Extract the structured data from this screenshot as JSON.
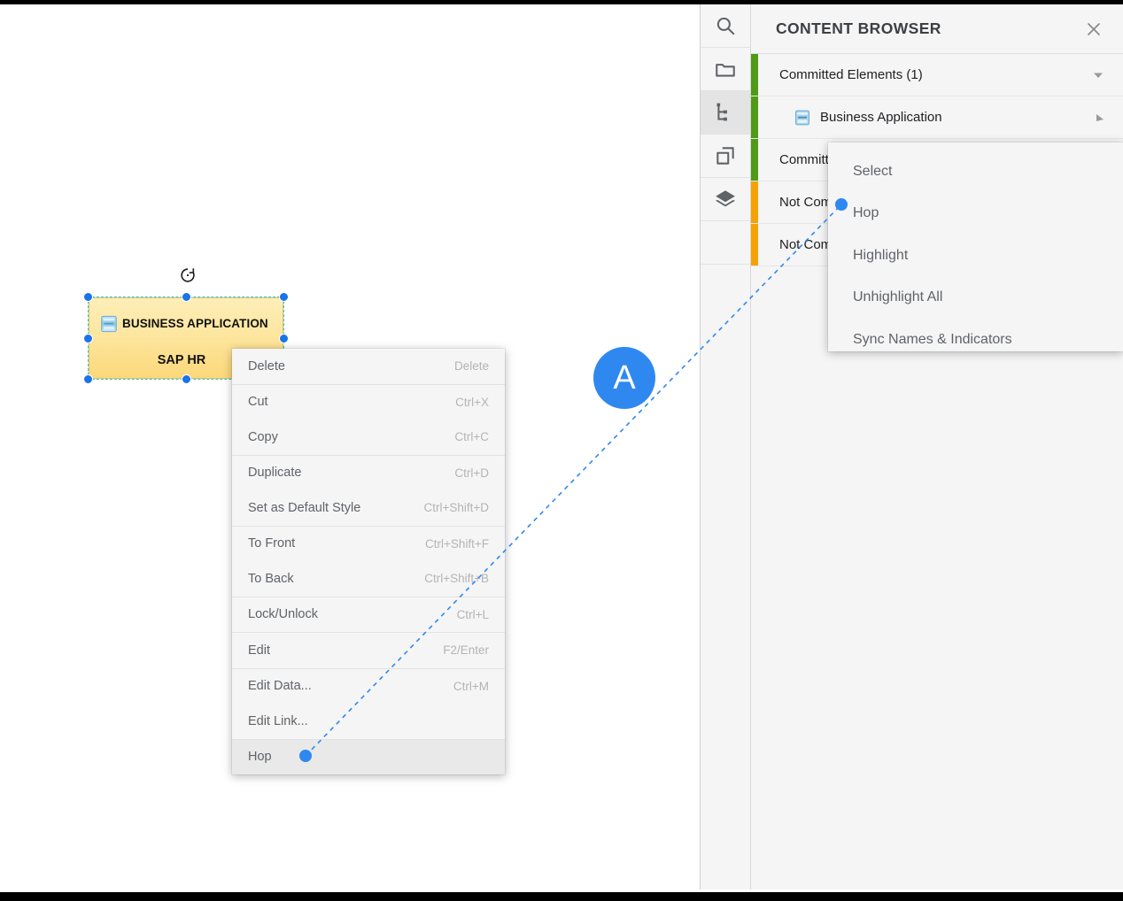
{
  "canvas": {
    "shape": {
      "icon": "business-application-icon",
      "title": "BUSINESS APPLICATION",
      "subtitle": "SAP HR",
      "rotate_icon": "rotate-icon",
      "fill_color": "#fde6a0",
      "selection_color": "#1a73e8",
      "dash_color": "#26c6da"
    }
  },
  "context_menu": {
    "groups": [
      [
        {
          "label": "Delete",
          "accel": "Delete",
          "highlighted": false
        }
      ],
      [
        {
          "label": "Cut",
          "accel": "Ctrl+X",
          "highlighted": false
        },
        {
          "label": "Copy",
          "accel": "Ctrl+C",
          "highlighted": false
        }
      ],
      [
        {
          "label": "Duplicate",
          "accel": "Ctrl+D",
          "highlighted": false
        },
        {
          "label": "Set as Default Style",
          "accel": "Ctrl+Shift+D",
          "highlighted": false
        }
      ],
      [
        {
          "label": "To Front",
          "accel": "Ctrl+Shift+F",
          "highlighted": false
        },
        {
          "label": "To Back",
          "accel": "Ctrl+Shift+B",
          "highlighted": false
        }
      ],
      [
        {
          "label": "Lock/Unlock",
          "accel": "Ctrl+L",
          "highlighted": false
        }
      ],
      [
        {
          "label": "Edit",
          "accel": "F2/Enter",
          "highlighted": false
        }
      ],
      [
        {
          "label": "Edit Data...",
          "accel": "Ctrl+M",
          "highlighted": false
        },
        {
          "label": "Edit Link...",
          "accel": "",
          "highlighted": false
        }
      ],
      [
        {
          "label": "Hop",
          "accel": "",
          "highlighted": true
        }
      ]
    ]
  },
  "right_panel": {
    "rail": [
      {
        "name": "search-icon",
        "active": false
      },
      {
        "name": "folder-icon",
        "active": false
      },
      {
        "name": "tree-icon",
        "active": true
      },
      {
        "name": "copy-icon",
        "active": false
      },
      {
        "name": "layers-icon",
        "active": false
      }
    ],
    "header": {
      "title": "CONTENT BROWSER",
      "close_icon": "close-icon"
    },
    "rows": [
      {
        "label": "Committed Elements (1)",
        "status_color": "#4f9a16",
        "indent": false,
        "icon": null,
        "tail": "chevron-down-icon"
      },
      {
        "label": "Business Application",
        "status_color": "#4f9a16",
        "indent": true,
        "icon": "business-application-icon",
        "tail": "arrow-right-icon"
      },
      {
        "label": "Committed",
        "status_color": "#4f9a16",
        "indent": false,
        "icon": null,
        "tail": null
      },
      {
        "label": "Not Committed",
        "status_color": "#f5a202",
        "indent": false,
        "icon": null,
        "tail": null
      },
      {
        "label": "Not Committed",
        "status_color": "#f5a202",
        "indent": false,
        "icon": null,
        "tail": null
      }
    ]
  },
  "submenu": {
    "items": [
      {
        "label": "Select"
      },
      {
        "label": "Hop"
      },
      {
        "label": "Highlight"
      },
      {
        "label": "Unhighlight All"
      },
      {
        "label": "Sync Names & Indicators"
      }
    ]
  },
  "annotation": {
    "marker_label": "A",
    "marker_color": "#2f88f0",
    "connector_style": "dashed"
  }
}
